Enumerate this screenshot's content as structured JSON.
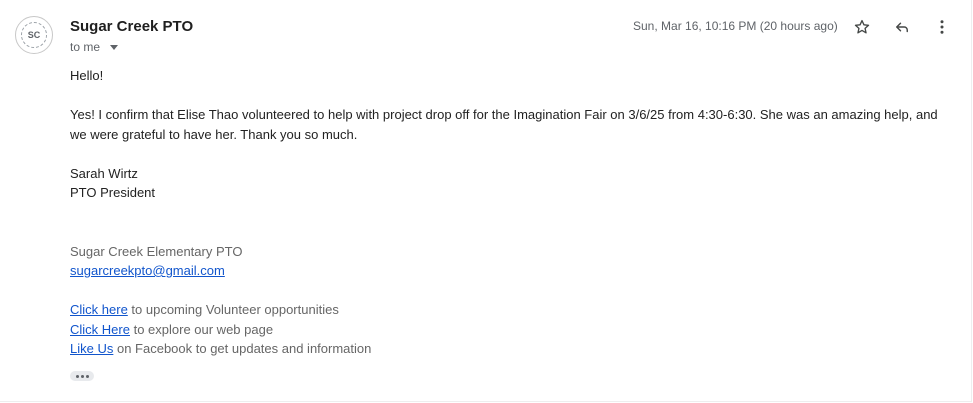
{
  "sender": {
    "avatar_text": "SC",
    "name": "Sugar Creek PTO",
    "recipient_label": "to me"
  },
  "timestamp": "Sun, Mar 16, 10:16 PM (20 hours ago)",
  "actions": {
    "star_icon": "star-icon",
    "reply_icon": "reply-icon",
    "more_icon": "more-vert-icon"
  },
  "message": {
    "greeting": "Hello!",
    "paragraph": "Yes!  I confirm that Elise Thao volunteered to help with project drop off for the Imagination Fair on 3/6/25 from 4:30-6:30.  She was an amazing help, and we were grateful to have her.  Thank you so much.",
    "signer_name": "Sarah Wirtz",
    "signer_title": "PTO President"
  },
  "signature": {
    "org": "Sugar Creek Elementary PTO",
    "email": "sugarcreekpto@gmail.com",
    "links": [
      {
        "link_text": "Click here",
        "rest": " to upcoming Volunteer opportunities"
      },
      {
        "link_text": "Click Here",
        "rest": " to explore our web page"
      },
      {
        "link_text": "Like Us",
        "rest": " on Facebook to get updates and information"
      }
    ]
  },
  "colors": {
    "link": "#1155cc",
    "muted": "#5f6368"
  }
}
